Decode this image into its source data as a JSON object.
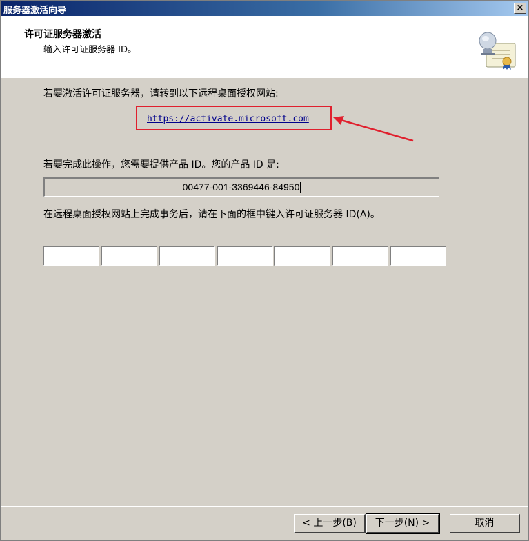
{
  "window": {
    "title": "服务器激活向导",
    "close_glyph": "×"
  },
  "header": {
    "title": "许可证服务器激活",
    "subtitle": "输入许可证服务器 ID。",
    "icon": "certificate-icon"
  },
  "body": {
    "instruction_visit": "若要激活许可证服务器，请转到以下远程桌面授权网站:",
    "activation_url": "https://activate.microsoft.com",
    "instruction_product_id": "若要完成此操作，您需要提供产品 ID。您的产品 ID 是:",
    "product_id": "00477-001-3369446-84950",
    "instruction_enter_id": "在远程桌面授权网站上完成事务后，请在下面的框中键入许可证服务器 ID(A)。",
    "license_id_fields": [
      "",
      "",
      "",
      "",
      "",
      "",
      ""
    ]
  },
  "highlight": {
    "box_color": "#e0202e",
    "arrow_color": "#e0202e"
  },
  "footer": {
    "back_label": "< 上一步(B)",
    "next_label": "下一步(N) >",
    "cancel_label": "取消"
  }
}
